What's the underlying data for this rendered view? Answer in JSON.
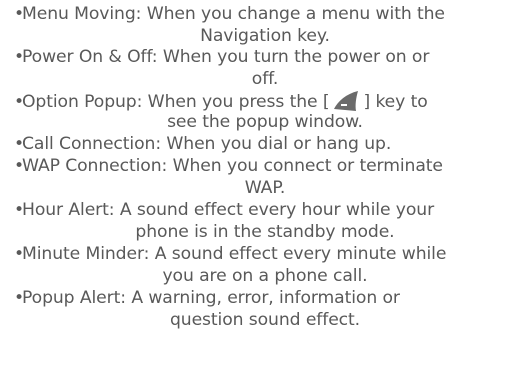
{
  "items": [
    {
      "term": "Menu Moving",
      "line1": "When you change a menu with the",
      "line2": "Navigation key."
    },
    {
      "term": "Power On & Off",
      "line1": "When you turn the power on or",
      "line2": "off."
    },
    {
      "term": "Option Popup",
      "line1_before": "When you press the [",
      "key_icon": "left-soft-key-icon",
      "line1_after": "] key to",
      "line2": "see the popup window."
    },
    {
      "term": "Call Connection",
      "line1": "When you dial or hang up."
    },
    {
      "term": "WAP Connection",
      "line1": "When you connect or terminate",
      "line2": "WAP."
    },
    {
      "term": "Hour Alert",
      "line1": "A sound effect every hour while your",
      "line2": "phone is in the standby mode."
    },
    {
      "term": "Minute Minder",
      "line1": "A sound effect every minute while",
      "line2": "you are on a phone call."
    },
    {
      "term": "Popup Alert",
      "line1": "A warning, error, information or",
      "line2": "question sound effect."
    }
  ],
  "bullet": "•",
  "separator": ": ",
  "colors": {
    "text": "#595959",
    "key_fill": "#6b6b6b"
  }
}
